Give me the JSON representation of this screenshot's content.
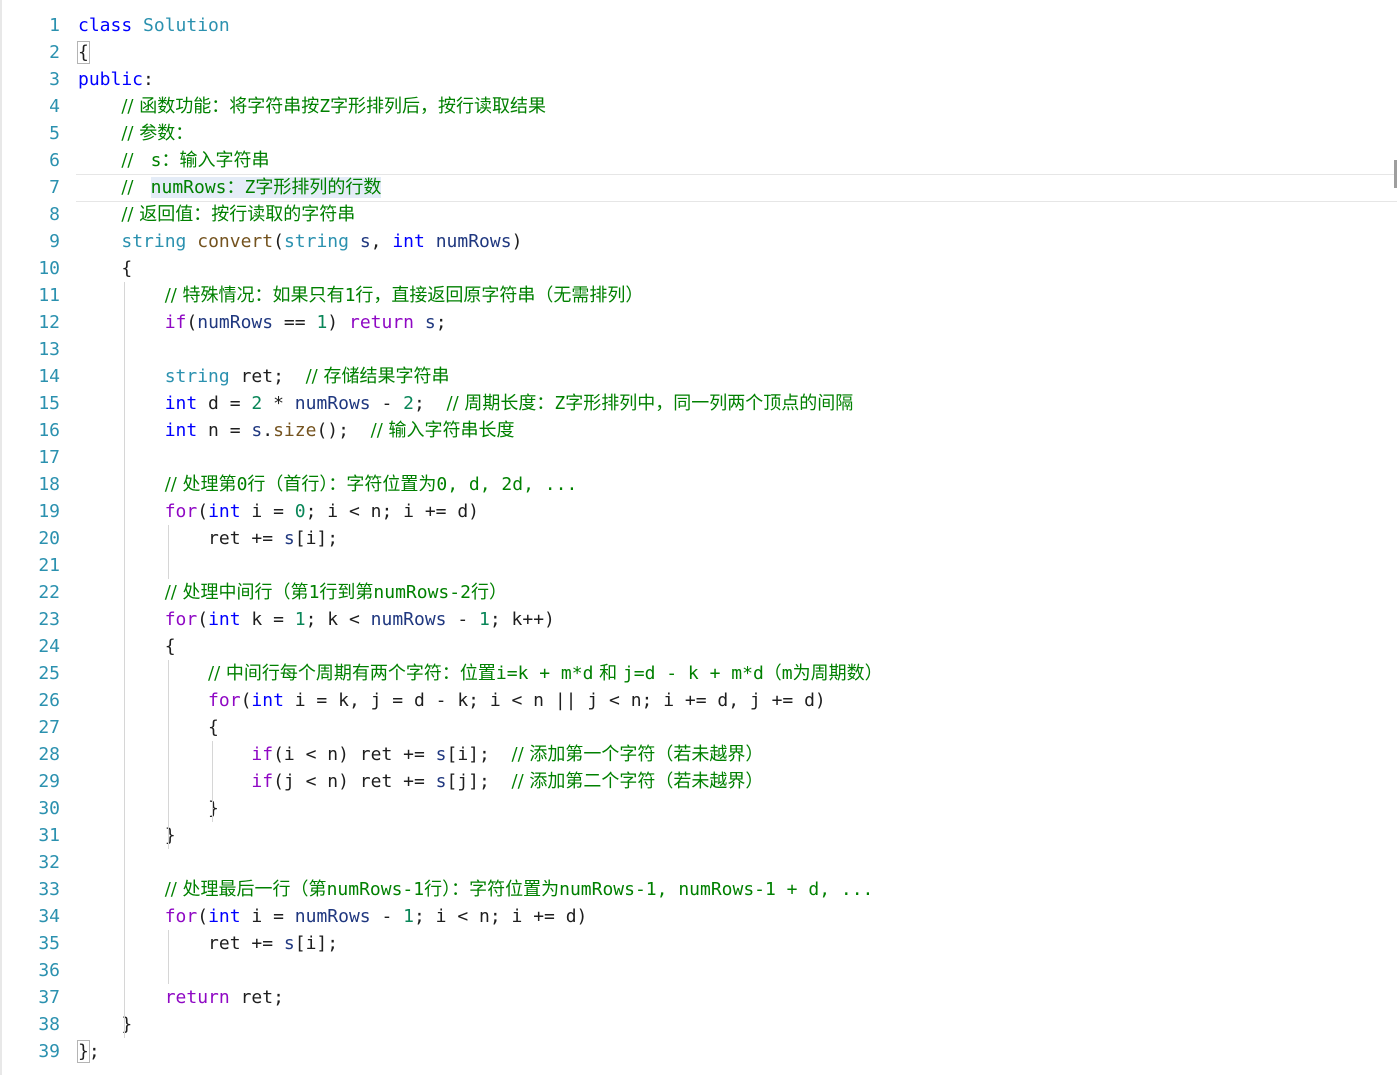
{
  "editor": {
    "lines": [
      {
        "n": "1",
        "html": "<span class=\"kw\">class</span> <span class=\"ty\">Solution</span>"
      },
      {
        "n": "2",
        "html": "<span class=\"brace-box\">{</span>"
      },
      {
        "n": "3",
        "html": "<span class=\"kw\">public</span>:"
      },
      {
        "n": "4",
        "html": "    <span class=\"cm\">// 函数功能：将字符串按<span class=\"m\">Z</span>字形排列后，按行读取结果</span>"
      },
      {
        "n": "5",
        "html": "    <span class=\"cm\">// 参数：</span>"
      },
      {
        "n": "6",
        "html": "    <span class=\"cm\">//   <span class=\"m\">s</span>：输入字符串</span>"
      },
      {
        "n": "7",
        "html": "    <span class=\"cm\">//   <span class=\"hl\"><span class=\"m\">numRows</span>：<span class=\"m\">Z</span>字形排列的行数</span></span>"
      },
      {
        "n": "8",
        "html": "    <span class=\"cm\">// 返回值：按行读取的字符串</span>"
      },
      {
        "n": "9",
        "html": "    <span class=\"ty\">string</span> <span class=\"fn\">convert</span>(<span class=\"ty\">string</span> <span class=\"id\">s</span>, <span class=\"kw\">int</span> <span class=\"id\">numRows</span>)"
      },
      {
        "n": "10",
        "html": "    {"
      },
      {
        "n": "11",
        "html": "        <span class=\"cm\">// 特殊情况：如果只有<span class=\"m\">1</span>行，直接返回原字符串（无需排列）</span>"
      },
      {
        "n": "12",
        "html": "        <span class=\"ctl\">if</span>(<span class=\"id\">numRows</span> == <span class=\"num\">1</span>) <span class=\"ctl\">return</span> <span class=\"id\">s</span>;"
      },
      {
        "n": "13",
        "html": ""
      },
      {
        "n": "14",
        "html": "        <span class=\"ty\">string</span> ret;  <span class=\"cm\">// 存储结果字符串</span>"
      },
      {
        "n": "15",
        "html": "        <span class=\"kw\">int</span> d = <span class=\"num\">2</span> * <span class=\"id\">numRows</span> - <span class=\"num\">2</span>;  <span class=\"cm\">// 周期长度：<span class=\"m\">Z</span>字形排列中，同一列两个顶点的间隔</span>"
      },
      {
        "n": "16",
        "html": "        <span class=\"kw\">int</span> n = <span class=\"id\">s</span>.<span class=\"fn\">size</span>();  <span class=\"cm\">// 输入字符串长度</span>"
      },
      {
        "n": "17",
        "html": ""
      },
      {
        "n": "18",
        "html": "        <span class=\"cm\">// 处理第<span class=\"m\">0</span>行（首行）：字符位置为<span class=\"m\">0, d, 2d, ...</span></span>"
      },
      {
        "n": "19",
        "html": "        <span class=\"ctl\">for</span>(<span class=\"kw\">int</span> i = <span class=\"num\">0</span>; i &lt; n; i += d)"
      },
      {
        "n": "20",
        "html": "            ret += <span class=\"id\">s</span>[i];"
      },
      {
        "n": "21",
        "html": ""
      },
      {
        "n": "22",
        "html": "        <span class=\"cm\">// 处理中间行（第<span class=\"m\">1</span>行到第<span class=\"m\">numRows-2</span>行）</span>"
      },
      {
        "n": "23",
        "html": "        <span class=\"ctl\">for</span>(<span class=\"kw\">int</span> k = <span class=\"num\">1</span>; k &lt; <span class=\"id\">numRows</span> - <span class=\"num\">1</span>; k++)"
      },
      {
        "n": "24",
        "html": "        {"
      },
      {
        "n": "25",
        "html": "            <span class=\"cm\">// 中间行每个周期有两个字符：位置<span class=\"m\">i=k + m*d</span> 和 <span class=\"m\">j=d - k + m*d</span>（<span class=\"m\">m</span>为周期数）</span>"
      },
      {
        "n": "26",
        "html": "            <span class=\"ctl\">for</span>(<span class=\"kw\">int</span> i = k, j = d - k; i &lt; n || j &lt; n; i += d, j += d)"
      },
      {
        "n": "27",
        "html": "            {"
      },
      {
        "n": "28",
        "html": "                <span class=\"ctl\">if</span>(i &lt; n) ret += <span class=\"id\">s</span>[i];  <span class=\"cm\">// 添加第一个字符（若未越界）</span>"
      },
      {
        "n": "29",
        "html": "                <span class=\"ctl\">if</span>(j &lt; n) ret += <span class=\"id\">s</span>[j];  <span class=\"cm\">// 添加第二个字符（若未越界）</span>"
      },
      {
        "n": "30",
        "html": "            }"
      },
      {
        "n": "31",
        "html": "        }"
      },
      {
        "n": "32",
        "html": ""
      },
      {
        "n": "33",
        "html": "        <span class=\"cm\">// 处理最后一行（第<span class=\"m\">numRows-1</span>行）：字符位置为<span class=\"m\">numRows-1, numRows-1 + d, ...</span></span>"
      },
      {
        "n": "34",
        "html": "        <span class=\"ctl\">for</span>(<span class=\"kw\">int</span> i = <span class=\"id\">numRows</span> - <span class=\"num\">1</span>; i &lt; n; i += d)"
      },
      {
        "n": "35",
        "html": "            ret += <span class=\"id\">s</span>[i];"
      },
      {
        "n": "36",
        "html": ""
      },
      {
        "n": "37",
        "html": "        <span class=\"ctl\">return</span> ret;"
      },
      {
        "n": "38",
        "html": "    }"
      },
      {
        "n": "39",
        "html": "<span class=\"brace-box\">}</span>;"
      }
    ],
    "current_line": 7
  }
}
